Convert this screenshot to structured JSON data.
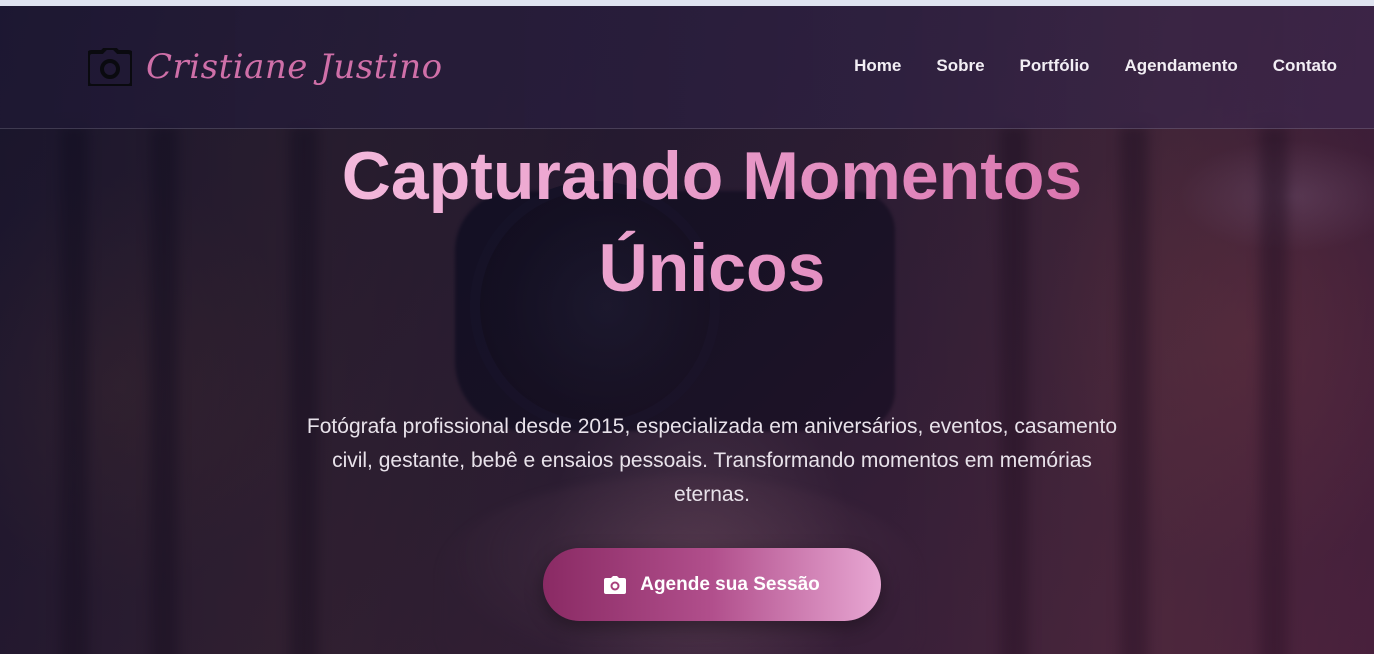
{
  "brand": {
    "name": "Cristiane Justino",
    "icon": "camera-icon",
    "color": "#cf6fa8"
  },
  "nav": {
    "items": [
      {
        "label": "Home"
      },
      {
        "label": "Sobre"
      },
      {
        "label": "Portfólio"
      },
      {
        "label": "Agendamento"
      },
      {
        "label": "Contato"
      }
    ]
  },
  "hero": {
    "headline_line1": "Capturando Momentos",
    "headline_line2": "Únicos",
    "description": "Fotógrafa profissional desde 2015, especializada em aniversários, eventos, casamento civil, gestante, bebê e ensaios pessoais. Transformando momentos em memórias eternas.",
    "cta_label": "Agende sua Sessão",
    "cta_icon": "camera-icon",
    "accent_colors": [
      "#f7c3e2",
      "#d66aa6",
      "#8a2a64"
    ]
  }
}
